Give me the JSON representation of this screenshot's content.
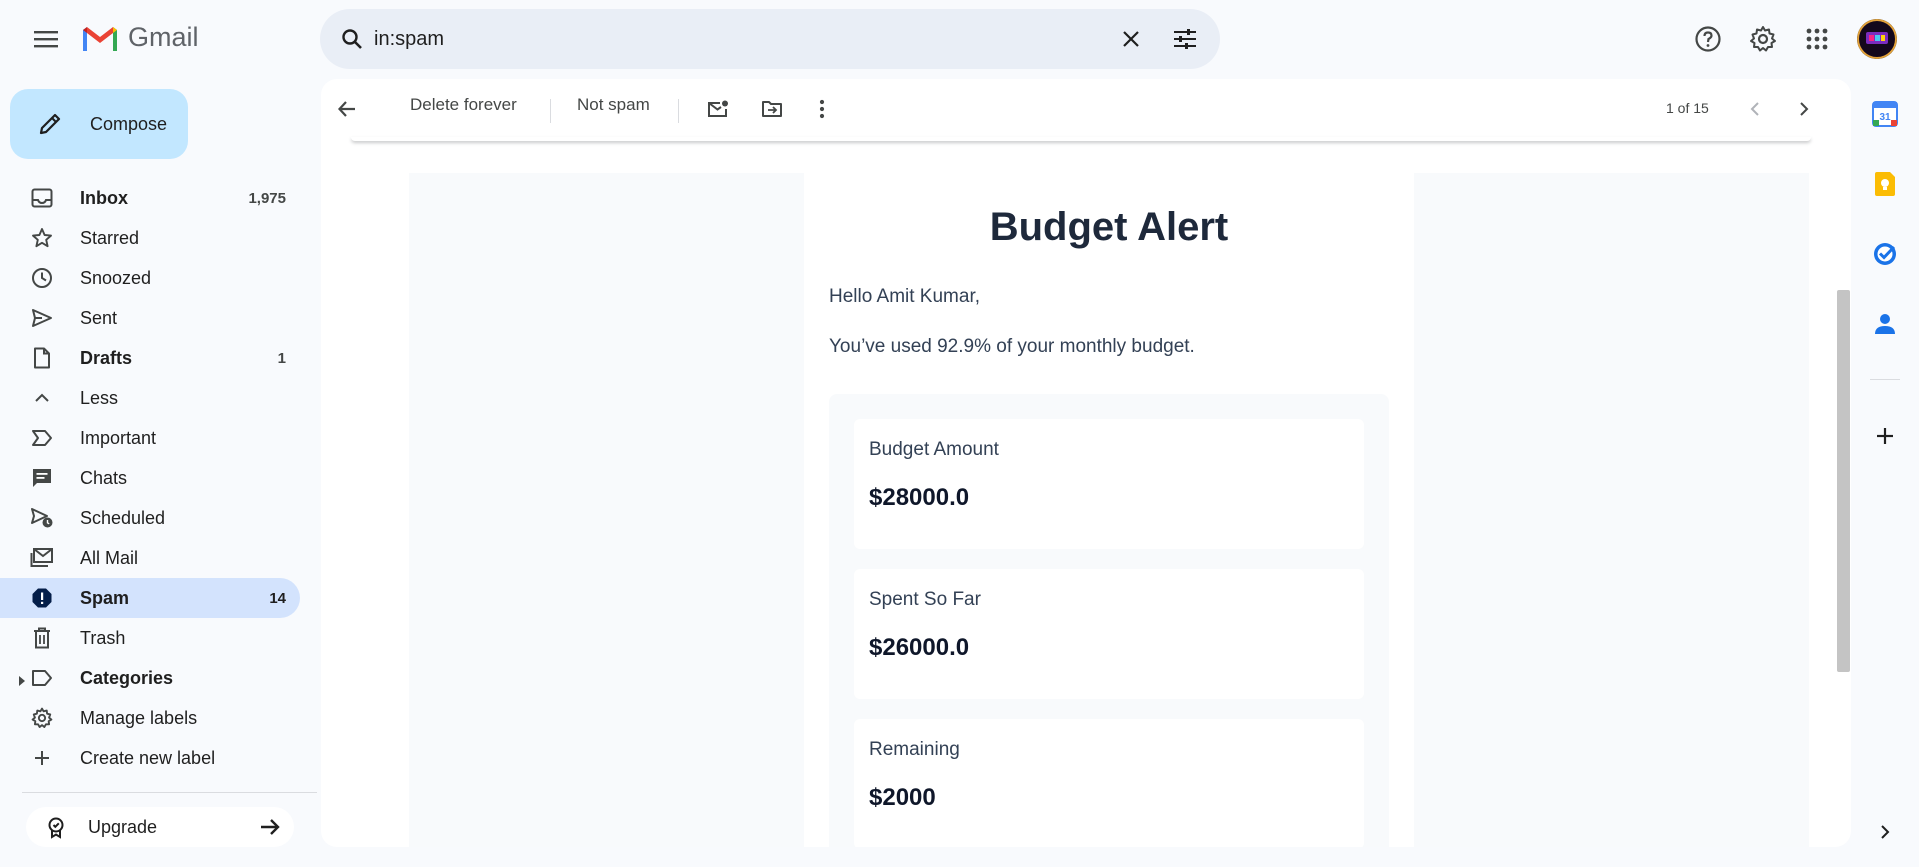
{
  "app": {
    "name": "Gmail",
    "search_query": "in:spam"
  },
  "compose": {
    "label": "Compose"
  },
  "nav": {
    "items": [
      {
        "label": "Inbox",
        "count": "1,975"
      },
      {
        "label": "Starred",
        "count": ""
      },
      {
        "label": "Snoozed",
        "count": ""
      },
      {
        "label": "Sent",
        "count": ""
      },
      {
        "label": "Drafts",
        "count": "1"
      },
      {
        "label": "Less",
        "count": ""
      },
      {
        "label": "Important",
        "count": ""
      },
      {
        "label": "Chats",
        "count": ""
      },
      {
        "label": "Scheduled",
        "count": ""
      },
      {
        "label": "All Mail",
        "count": ""
      },
      {
        "label": "Spam",
        "count": "14"
      },
      {
        "label": "Trash",
        "count": ""
      },
      {
        "label": "Categories",
        "count": ""
      },
      {
        "label": "Manage labels",
        "count": ""
      },
      {
        "label": "Create new label",
        "count": ""
      }
    ],
    "upgrade_label": "Upgrade"
  },
  "toolbar": {
    "delete_forever": "Delete forever",
    "not_spam": "Not spam",
    "pager": "1 of 15"
  },
  "email": {
    "title": "Budget Alert",
    "greeting": "Hello Amit Kumar,",
    "usage_text": "You’ve used 92.9% of your monthly budget.",
    "stats": [
      {
        "label": "Budget Amount",
        "value": "$28000.0"
      },
      {
        "label": "Spent So Far",
        "value": "$26000.0"
      },
      {
        "label": "Remaining",
        "value": "$2000"
      }
    ]
  },
  "side_panel": {
    "calendar_day": "31"
  },
  "icons": {
    "menu": "menu-icon",
    "search": "search-icon",
    "clear": "close-icon",
    "filters": "tune-icon",
    "help": "help-icon",
    "settings": "gear-icon",
    "apps": "apps-grid-icon",
    "back": "arrow-back-icon"
  },
  "colors": {
    "compose_bg": "#c2e7ff",
    "active_nav": "#d3e3fd",
    "search_bg": "#e9eef6",
    "page_bg": "#f8fafd"
  }
}
